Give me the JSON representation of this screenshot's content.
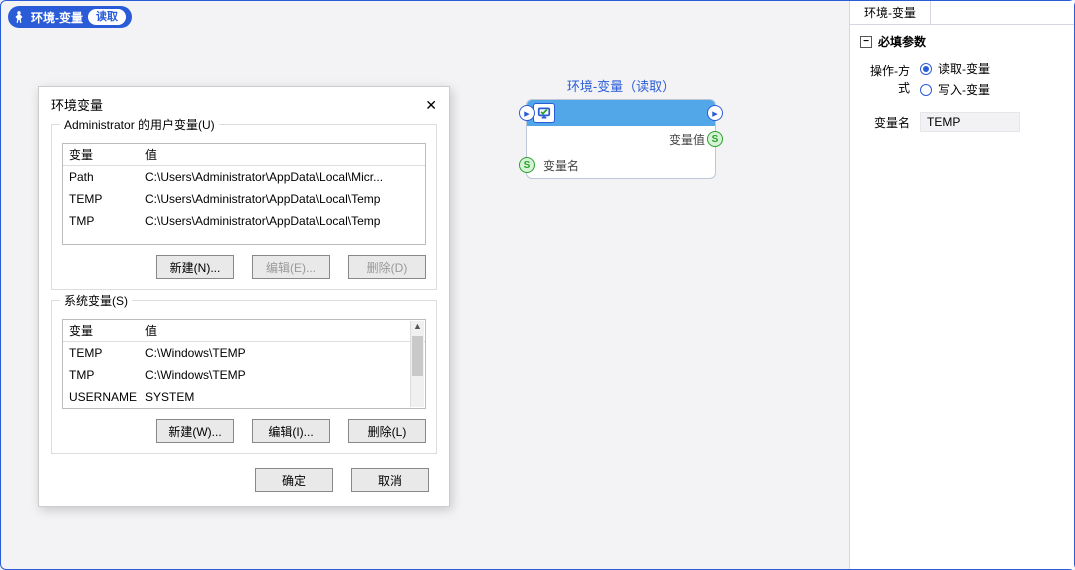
{
  "pill": {
    "title": "环境-变量",
    "badge": "读取"
  },
  "node": {
    "title": "环境-变量（读取）",
    "out_value": "变量值",
    "out_name": "变量名",
    "port_glyph": "▸",
    "s_glyph": "S"
  },
  "dialog": {
    "title": "环境变量",
    "user_group_label": "Administrator 的用户变量(U)",
    "sys_group_label": "系统变量(S)",
    "head_var": "变量",
    "head_val": "值",
    "user_rows": [
      {
        "name": "Path",
        "value": "C:\\Users\\Administrator\\AppData\\Local\\Micr..."
      },
      {
        "name": "TEMP",
        "value": "C:\\Users\\Administrator\\AppData\\Local\\Temp"
      },
      {
        "name": "TMP",
        "value": "C:\\Users\\Administrator\\AppData\\Local\\Temp"
      }
    ],
    "sys_rows": [
      {
        "name": "TEMP",
        "value": "C:\\Windows\\TEMP"
      },
      {
        "name": "TMP",
        "value": "C:\\Windows\\TEMP"
      },
      {
        "name": "USERNAME",
        "value": "SYSTEM"
      }
    ],
    "btn_new_u": "新建(N)...",
    "btn_edit_u": "编辑(E)...",
    "btn_del_u": "删除(D)",
    "btn_new_s": "新建(W)...",
    "btn_edit_s": "编辑(I)...",
    "btn_del_s": "删除(L)",
    "ok": "确定",
    "cancel": "取消"
  },
  "panel": {
    "tab": "环境-变量",
    "section": "必填参数",
    "collapse_glyph": "−",
    "op_label": "操作-方式",
    "radio_read": "读取-变量",
    "radio_write": "写入-变量",
    "varname_label": "变量名",
    "varname_value": "TEMP"
  }
}
